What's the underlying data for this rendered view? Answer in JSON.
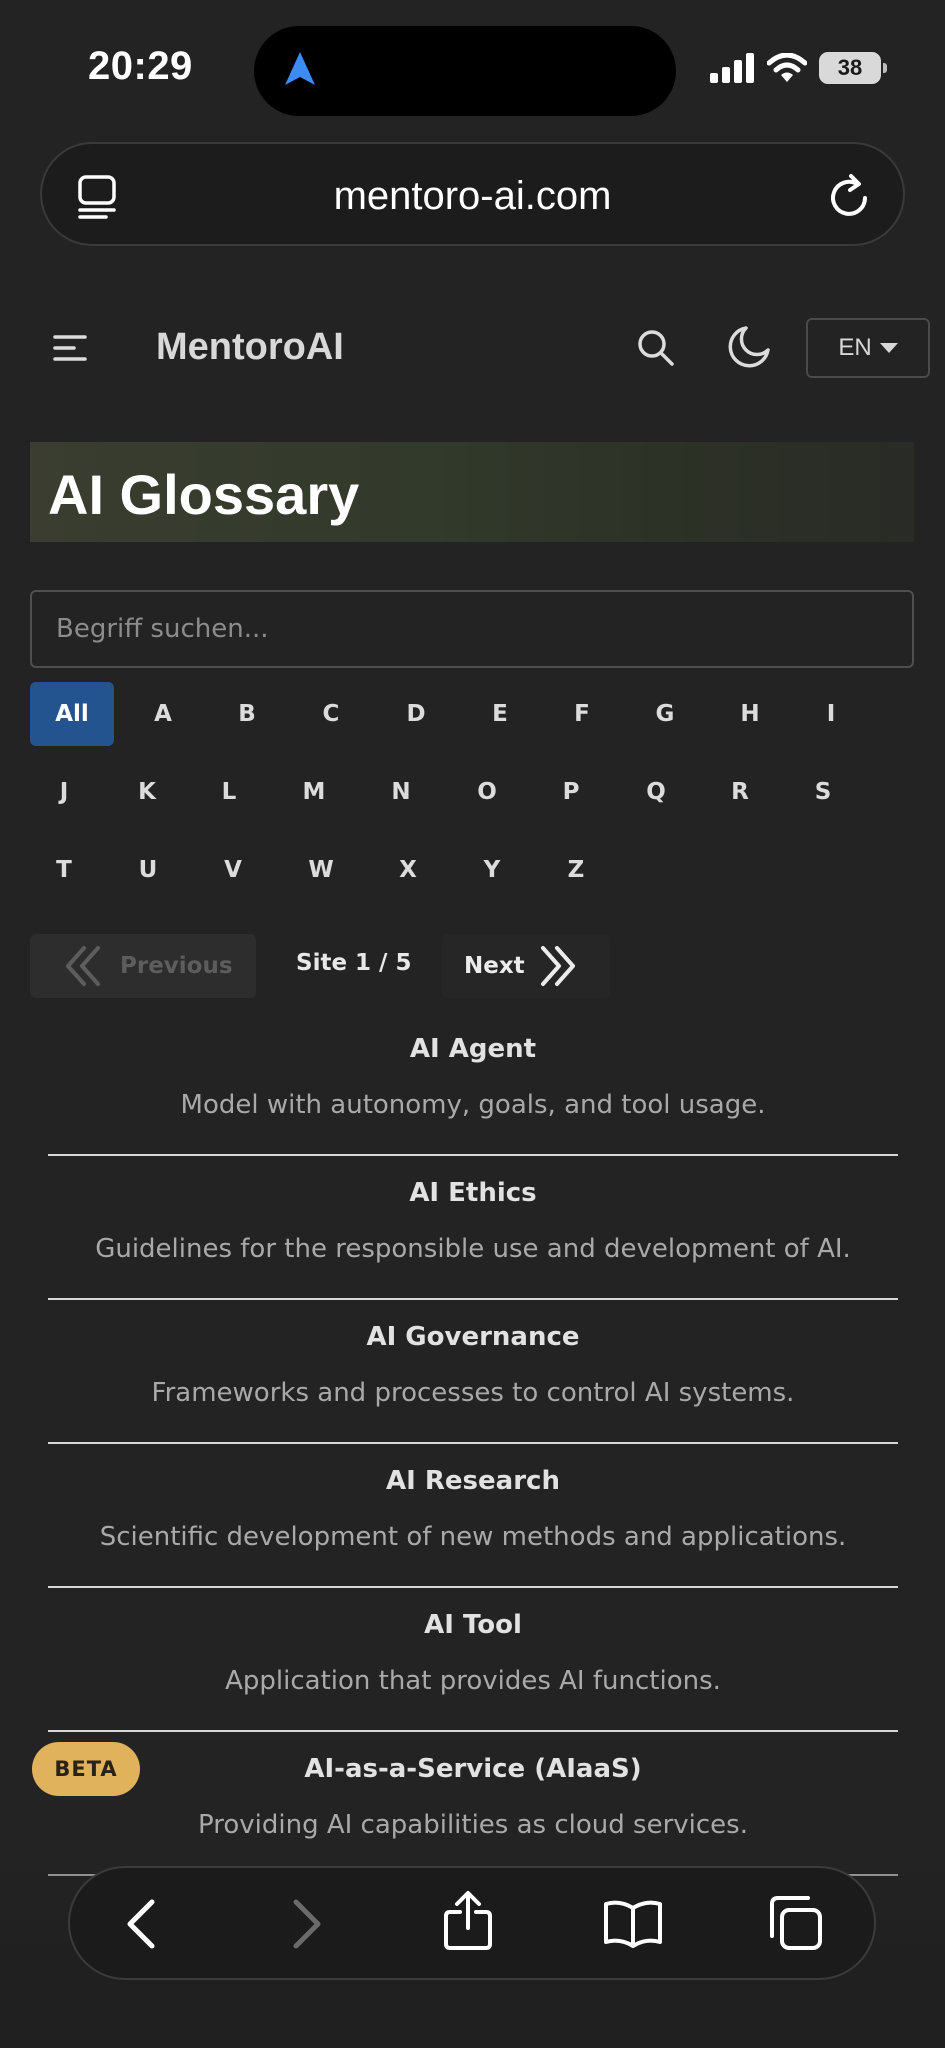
{
  "status": {
    "time": "20:29",
    "battery": "38"
  },
  "browser": {
    "url": "mentoro-ai.com"
  },
  "header": {
    "brand": "MentoroAI",
    "language": "EN"
  },
  "page": {
    "title": "AI Glossary",
    "search_placeholder": "Begriff suchen..."
  },
  "letters": [
    "All",
    "A",
    "B",
    "C",
    "D",
    "E",
    "F",
    "G",
    "H",
    "I",
    "J",
    "K",
    "L",
    "M",
    "N",
    "O",
    "P",
    "Q",
    "R",
    "S",
    "T",
    "U",
    "V",
    "W",
    "X",
    "Y",
    "Z"
  ],
  "active_letter": "All",
  "pagination": {
    "previous": "Previous",
    "info": "Site 1 / 5",
    "next": "Next"
  },
  "entries": [
    {
      "title": "AI Agent",
      "description": "Model with autonomy, goals, and tool usage."
    },
    {
      "title": "AI Ethics",
      "description": "Guidelines for the responsible use and development of AI."
    },
    {
      "title": "AI Governance",
      "description": "Frameworks and processes to control AI systems."
    },
    {
      "title": "AI Research",
      "description": "Scientific development of new methods and applications."
    },
    {
      "title": "AI Tool",
      "description": "Application that provides AI functions."
    },
    {
      "title": "AI-as-a-Service (AIaaS)",
      "description": "Providing AI capabilities as cloud services."
    }
  ],
  "badge": "BETA",
  "icons": {
    "status": [
      "location-arrow-icon",
      "cellular-signal-icon",
      "wifi-icon",
      "battery-icon"
    ],
    "browser": [
      "tab-overview-icon",
      "reload-icon"
    ],
    "header": [
      "menu-icon",
      "search-icon",
      "dark-mode-moon-icon",
      "dropdown-caret-icon"
    ],
    "toolbar": [
      "back-icon",
      "forward-icon",
      "share-icon",
      "bookmarks-icon",
      "tabs-icon"
    ]
  },
  "colors": {
    "background": "#232323",
    "active_letter": "#23548f",
    "beta_badge": "#e0b25c",
    "location_arrow": "#3d8bf5"
  }
}
